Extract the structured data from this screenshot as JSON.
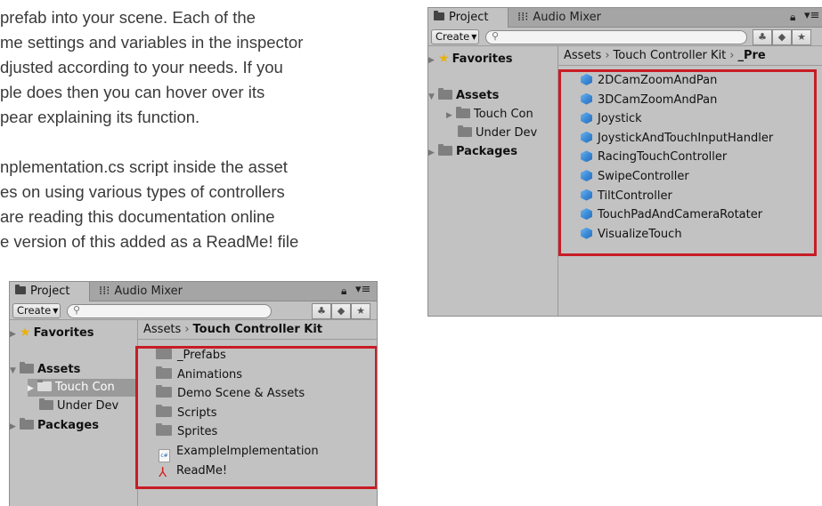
{
  "doc_lines": [
    "prefab into your scene. Each of the",
    "me settings and variables in the inspector",
    "djusted according to your needs. If you",
    "ple does then you can hover over its",
    "pear explaining its function.",
    "nplementation.cs script inside the asset",
    "es on using various types of controllers",
    "are reading this documentation online",
    "e version of this added as a ReadMe! file"
  ],
  "left_panel": {
    "tabs": {
      "project": "Project",
      "audio_mixer": "Audio Mixer"
    },
    "toolbar": {
      "create_label": "Create"
    },
    "sidebar": {
      "favorites": "Favorites",
      "assets": "Assets",
      "touch_controller": "Touch Con",
      "under_dev": "Under Dev",
      "packages": "Packages"
    },
    "breadcrumb": {
      "root": "Assets",
      "current": "Touch Controller Kit"
    },
    "items": [
      {
        "name": "_Prefabs",
        "icon": "folder-icon"
      },
      {
        "name": "Animations",
        "icon": "folder-icon"
      },
      {
        "name": "Demo Scene & Assets",
        "icon": "folder-icon"
      },
      {
        "name": "Scripts",
        "icon": "folder-icon"
      },
      {
        "name": "Sprites",
        "icon": "folder-icon"
      },
      {
        "name": "ExampleImplementation",
        "icon": "csharp-script-icon"
      },
      {
        "name": "ReadMe!",
        "icon": "pdf-icon"
      }
    ]
  },
  "right_panel": {
    "tabs": {
      "project": "Project",
      "audio_mixer": "Audio Mixer"
    },
    "toolbar": {
      "create_label": "Create"
    },
    "sidebar": {
      "favorites": "Favorites",
      "assets": "Assets",
      "touch_controller": "Touch Con",
      "under_dev": "Under Dev",
      "packages": "Packages"
    },
    "breadcrumb": {
      "root": "Assets",
      "middle": "Touch Controller Kit",
      "current": "_Pre"
    },
    "items": [
      {
        "name": "2DCamZoomAndPan",
        "icon": "prefab-icon"
      },
      {
        "name": "3DCamZoomAndPan",
        "icon": "prefab-icon"
      },
      {
        "name": "Joystick",
        "icon": "prefab-icon"
      },
      {
        "name": "JoystickAndTouchInputHandler",
        "icon": "prefab-icon"
      },
      {
        "name": "RacingTouchController",
        "icon": "prefab-icon"
      },
      {
        "name": "SwipeController",
        "icon": "prefab-icon"
      },
      {
        "name": "TiltController",
        "icon": "prefab-icon"
      },
      {
        "name": "TouchPadAndCameraRotater",
        "icon": "prefab-icon"
      },
      {
        "name": "VisualizeTouch",
        "icon": "prefab-icon"
      }
    ]
  },
  "colors": {
    "highlight_box": "#c81c26",
    "panel_bg": "#c2c2c2",
    "favorites_star": "#e8b20c"
  }
}
